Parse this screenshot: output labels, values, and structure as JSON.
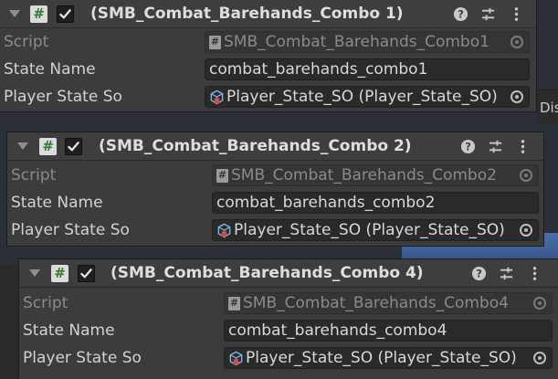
{
  "components": [
    {
      "title": "(SMB_Combat_Barehands_Combo 1)",
      "enabled": true,
      "fields": {
        "script": {
          "label": "Script",
          "value": "SMB_Combat_Barehands_Combo1"
        },
        "state_name": {
          "label": "State Name",
          "value": "combat_barehands_combo1"
        },
        "player_state_so": {
          "label": "Player State So",
          "value": "Player_State_SO (Player_State_SO)"
        }
      }
    },
    {
      "title": "(SMB_Combat_Barehands_Combo 2)",
      "enabled": true,
      "fields": {
        "script": {
          "label": "Script",
          "value": "SMB_Combat_Barehands_Combo2"
        },
        "state_name": {
          "label": "State Name",
          "value": "combat_barehands_combo2"
        },
        "player_state_so": {
          "label": "Player State So",
          "value": "Player_State_SO (Player_State_SO)"
        }
      }
    },
    {
      "title": "(SMB_Combat_Barehands_Combo 4)",
      "enabled": true,
      "fields": {
        "script": {
          "label": "Script",
          "value": "SMB_Combat_Barehands_Combo4"
        },
        "state_name": {
          "label": "State Name",
          "value": "combat_barehands_combo4"
        },
        "player_state_so": {
          "label": "Player State So",
          "value": "Player_State_SO (Player_State_SO)"
        }
      }
    }
  ],
  "background": {
    "partial_text": "Dis"
  },
  "icons": {
    "foldout": "foldout-arrow-icon",
    "script": "csharp-script-icon",
    "help": "help-icon",
    "presets": "presets-sliders-icon",
    "menu": "kebab-menu-icon",
    "object_picker": "object-picker-icon",
    "scriptable_object": "scriptable-object-icon"
  },
  "colors": {
    "panel_bg": "#3c3c3c",
    "field_bg": "#2a2a2a",
    "text": "#d2d2d2",
    "dim_text": "#8a8a8a"
  }
}
